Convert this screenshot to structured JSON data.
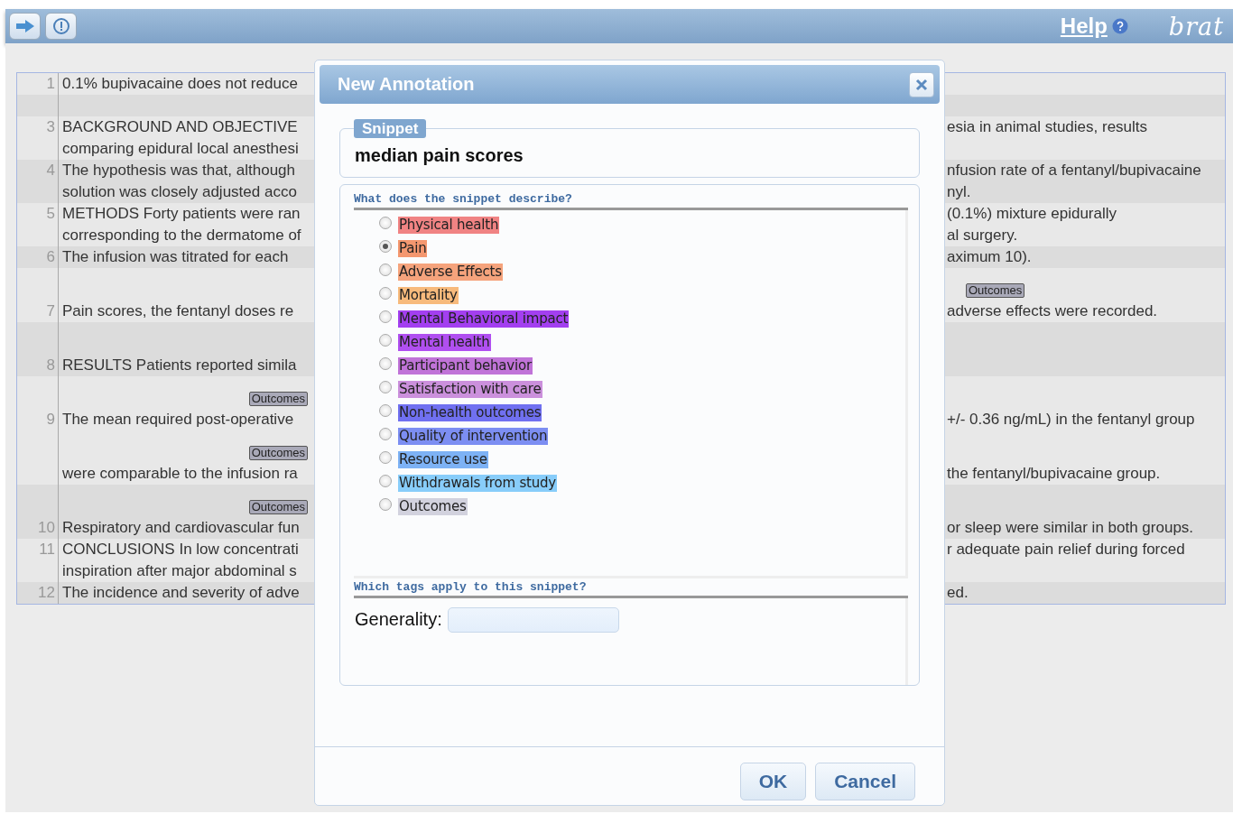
{
  "toolbar": {
    "help": "Help",
    "logo": "brat"
  },
  "document": {
    "rows": [
      {
        "kind": "text",
        "number": "1",
        "lines": [
          {
            "left": "0.1% bupivacaine does not reduce"
          }
        ]
      },
      {
        "kind": "blank"
      },
      {
        "kind": "text",
        "number": "3",
        "lines": [
          {
            "left": "BACKGROUND AND OBJECTIVE",
            "right": "esia in animal studies, results"
          },
          {
            "left": "comparing epidural local anesthesi"
          }
        ]
      },
      {
        "kind": "text",
        "number": "4",
        "lines": [
          {
            "left": "The hypothesis was that, although",
            "right": "nfusion rate of a fentanyl/bupivacaine"
          },
          {
            "left": "solution was closely adjusted acco",
            "right": "nyl."
          }
        ]
      },
      {
        "kind": "text",
        "number": "5",
        "lines": [
          {
            "left": "METHODS Forty patients were ran",
            "right": "(0.1%) mixture epidurally"
          },
          {
            "left": "corresponding to the dermatome of",
            "right": "al surgery."
          }
        ]
      },
      {
        "kind": "text",
        "number": "6",
        "lines": [
          {
            "left": "The infusion was titrated for each",
            "right": "aximum 10)."
          }
        ]
      },
      {
        "kind": "text",
        "number": "7",
        "lines": [
          {
            "left": "Pain scores, the fentanyl doses re",
            "right": "adverse effects were recorded.",
            "annotation_row": true,
            "label_right": "Outcomes"
          }
        ]
      },
      {
        "kind": "text",
        "number": "8",
        "lines": [
          {
            "left": "RESULTS Patients reported simila",
            "annotation_row": true
          }
        ]
      },
      {
        "kind": "text",
        "number": "9",
        "lines": [
          {
            "left": "The mean required post-operative",
            "right": "+/- 0.36 ng/mL) in the fentanyl group",
            "annotation_row": true,
            "label_left": "Outcomes"
          },
          {
            "left": "were comparable to the infusion ra",
            "right": "the fentanyl/bupivacaine group.",
            "annotation_row": true,
            "label_left": "Outcomes"
          }
        ]
      },
      {
        "kind": "text",
        "number": "10",
        "lines": [
          {
            "left": "Respiratory and cardiovascular fun",
            "right": "or sleep were similar in both groups.",
            "annotation_row": true,
            "label_left": "Outcomes"
          }
        ]
      },
      {
        "kind": "text",
        "number": "11",
        "lines": [
          {
            "left": "CONCLUSIONS In low concentrati",
            "right": "r adequate pain relief during forced"
          },
          {
            "left": "inspiration after major abdominal s"
          }
        ]
      },
      {
        "kind": "text",
        "number": "12",
        "lines": [
          {
            "left": "The incidence and severity of adve",
            "right": "ed."
          }
        ]
      }
    ]
  },
  "dialog": {
    "title": "New Annotation",
    "snippet_legend": "Snippet",
    "snippet": "median pain scores",
    "type_heading": "What does the snippet describe?",
    "types": [
      {
        "label": "Physical health",
        "selected": false,
        "color": "#f08383"
      },
      {
        "label": "Pain",
        "selected": true,
        "color": "#f4976f"
      },
      {
        "label": "Adverse Effects",
        "selected": false,
        "color": "#f5a37c"
      },
      {
        "label": "Mortality",
        "selected": false,
        "color": "#f7ba7c"
      },
      {
        "label": "Mental Behavioral impact",
        "selected": false,
        "color": "#a33ff0"
      },
      {
        "label": "Mental health",
        "selected": false,
        "color": "#b04ff0"
      },
      {
        "label": "Participant behavior",
        "selected": false,
        "color": "#c073d8"
      },
      {
        "label": "Satisfaction with care",
        "selected": false,
        "color": "#cb90dc"
      },
      {
        "label": "Non-health outcomes",
        "selected": false,
        "color": "#7070f0"
      },
      {
        "label": "Quality of intervention",
        "selected": false,
        "color": "#7c8ef2"
      },
      {
        "label": "Resource use",
        "selected": false,
        "color": "#7db2f5"
      },
      {
        "label": "Withdrawals from study",
        "selected": false,
        "color": "#88cdfa"
      },
      {
        "label": "Outcomes",
        "selected": false,
        "color": "#d2d2de"
      }
    ],
    "tags_heading": "Which tags apply to this snippet?",
    "generality_label": "Generality:",
    "buttons": [
      "OK",
      "Cancel"
    ]
  }
}
